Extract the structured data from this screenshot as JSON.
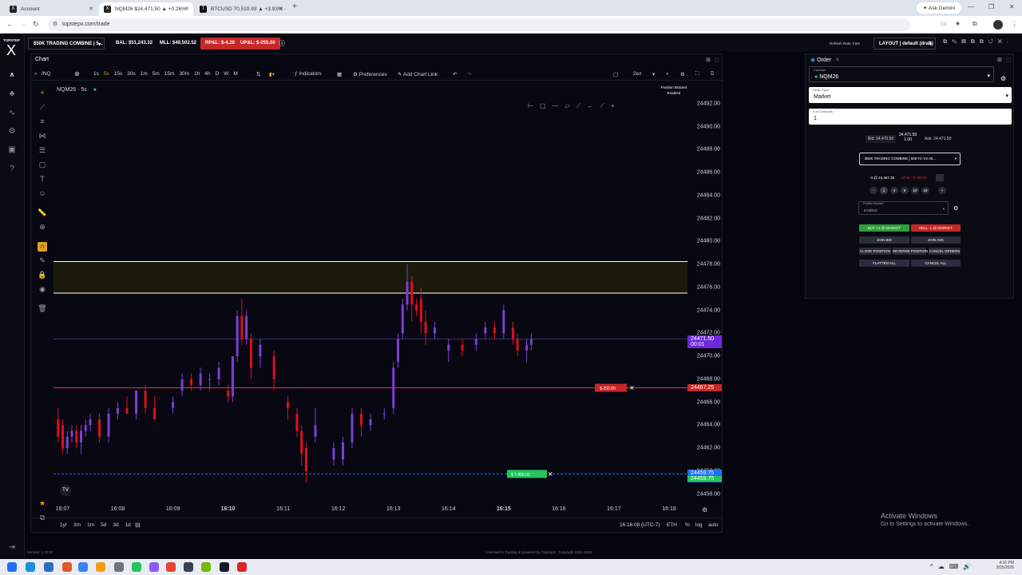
{
  "browser": {
    "tabs": [
      {
        "label": "Account",
        "active": false
      },
      {
        "label": "NQM26 $24,471.50 ▲ +0.26%",
        "active": true
      },
      {
        "label": "BTCUSD 70,510.93 ▲ +3.93% ·",
        "active": false
      }
    ],
    "url": "topstepx.com/trade",
    "profile_label": "Ask Gemini"
  },
  "app": {
    "brand": "TOPSTEP",
    "brand_mark": "X",
    "account_selector": "$50K TRADING COMBINE | 5...",
    "balance": "BAL: $51,243.32",
    "mll": "MLL: $49,502.52",
    "rpnl": "RP&L: $-4.20",
    "upnl": "UP&L: $-255.00",
    "refresh_status": "Refresh Rate: Fast",
    "layout_selector": "LAYOUT | default (draft)",
    "version": "Version: 1.22.57",
    "footer": "Licensed to Topstep & powered by TopstepX. Copyright 2024-2026"
  },
  "chart": {
    "panel_title": "Chart",
    "symbol_search": "/NQ",
    "timeframes": [
      "1s",
      "5s",
      "15s",
      "30s",
      "1m",
      "5m",
      "15m",
      "30m",
      "1h",
      "4h",
      "D",
      "W",
      "M"
    ],
    "active_timeframe": "5s",
    "indicators_label": "Indicators",
    "preferences_label": "Preferences",
    "add_chart_link_label": "Add Chart Link",
    "layout_code": "2ez",
    "legend": "NQM26 · 5s",
    "position_bracket_title": "Position Bracket",
    "position_bracket_status": "Enabled",
    "price_ticks": [
      "24492.00",
      "24490.00",
      "24488.00",
      "24486.00",
      "24484.00",
      "24482.00",
      "24480.00",
      "24478.00",
      "24476.00",
      "24474.00",
      "24472.00",
      "24470.00",
      "24468.00",
      "24466.00",
      "24464.00",
      "24462.00",
      "24460.00",
      "24458.00"
    ],
    "time_ticks": [
      "16:07",
      "16:08",
      "16:09",
      "16:10",
      "16:11",
      "16:12",
      "16:13",
      "16:14",
      "16:15",
      "16:16",
      "16:17",
      "16:18"
    ],
    "bold_time_ticks": [
      "16:10",
      "16:15"
    ],
    "last_price_label": "24471.50",
    "countdown_label": "00:01",
    "position_price_label": "24467.25",
    "position_pnl_tag": "$-255.00",
    "target_price_label": "24459.75",
    "target_price_label2": "24459.75",
    "target_tag": "$ 7,456.00",
    "range_buttons": [
      "1yr",
      "3m",
      "1m",
      "5d",
      "3d",
      "1d"
    ],
    "clock": "16:16:08 (UTC-7)",
    "session": "ETH",
    "scale_options": [
      "%",
      "log",
      "auto"
    ]
  },
  "chart_data": {
    "type": "candlestick",
    "title": "",
    "symbol": "NQM26",
    "interval": "5s",
    "x_range": [
      "16:06:50",
      "16:18:20"
    ],
    "ylim": [
      24457,
      24494
    ],
    "candles": [
      {
        "t": "16:06:55",
        "o": 24464.5,
        "h": 24465.5,
        "l": 24462.5,
        "c": 24463.0
      },
      {
        "t": "16:07:00",
        "o": 24464.0,
        "h": 24464.5,
        "l": 24461.5,
        "c": 24462.0
      },
      {
        "t": "16:07:05",
        "o": 24462.0,
        "h": 24463.5,
        "l": 24461.5,
        "c": 24463.0
      },
      {
        "t": "16:07:10",
        "o": 24463.0,
        "h": 24464.0,
        "l": 24462.5,
        "c": 24463.5
      },
      {
        "t": "16:07:15",
        "o": 24463.5,
        "h": 24464.0,
        "l": 24462.0,
        "c": 24462.5
      },
      {
        "t": "16:07:20",
        "o": 24462.5,
        "h": 24464.0,
        "l": 24461.5,
        "c": 24463.5
      },
      {
        "t": "16:07:25",
        "o": 24463.5,
        "h": 24464.5,
        "l": 24463.0,
        "c": 24464.0
      },
      {
        "t": "16:07:30",
        "o": 24464.0,
        "h": 24465.0,
        "l": 24463.5,
        "c": 24464.5
      },
      {
        "t": "16:07:40",
        "o": 24464.5,
        "h": 24465.0,
        "l": 24462.5,
        "c": 24463.0
      },
      {
        "t": "16:07:50",
        "o": 24463.0,
        "h": 24465.5,
        "l": 24462.5,
        "c": 24465.0
      },
      {
        "t": "16:08:00",
        "o": 24465.0,
        "h": 24466.0,
        "l": 24464.5,
        "c": 24465.5
      },
      {
        "t": "16:08:10",
        "o": 24465.5,
        "h": 24466.5,
        "l": 24465.0,
        "c": 24465.0
      },
      {
        "t": "16:08:20",
        "o": 24465.0,
        "h": 24467.0,
        "l": 24464.5,
        "c": 24467.0
      },
      {
        "t": "16:08:30",
        "o": 24467.0,
        "h": 24467.5,
        "l": 24465.0,
        "c": 24465.5
      },
      {
        "t": "16:08:40",
        "o": 24465.5,
        "h": 24466.5,
        "l": 24464.5,
        "c": 24464.5
      },
      {
        "t": "16:09:00",
        "o": 24465.5,
        "h": 24466.5,
        "l": 24465.0,
        "c": 24466.0
      },
      {
        "t": "16:09:10",
        "o": 24467.0,
        "h": 24468.5,
        "l": 24466.5,
        "c": 24468.0
      },
      {
        "t": "16:09:20",
        "o": 24468.0,
        "h": 24468.5,
        "l": 24467.0,
        "c": 24467.5
      },
      {
        "t": "16:09:30",
        "o": 24467.5,
        "h": 24469.0,
        "l": 24467.0,
        "c": 24468.5
      },
      {
        "t": "16:09:40",
        "o": 24468.0,
        "h": 24468.5,
        "l": 24467.0,
        "c": 24468.0
      },
      {
        "t": "16:09:50",
        "o": 24468.0,
        "h": 24469.5,
        "l": 24467.5,
        "c": 24469.0
      },
      {
        "t": "16:10:00",
        "o": 24467.0,
        "h": 24467.5,
        "l": 24466.0,
        "c": 24466.5
      },
      {
        "t": "16:10:05",
        "o": 24466.5,
        "h": 24470.0,
        "l": 24466.0,
        "c": 24470.0
      },
      {
        "t": "16:10:10",
        "o": 24470.0,
        "h": 24474.0,
        "l": 24469.5,
        "c": 24473.5
      },
      {
        "t": "16:10:15",
        "o": 24473.5,
        "h": 24475.0,
        "l": 24471.0,
        "c": 24471.5
      },
      {
        "t": "16:10:20",
        "o": 24471.5,
        "h": 24474.0,
        "l": 24471.0,
        "c": 24473.5
      },
      {
        "t": "16:10:25",
        "o": 24471.5,
        "h": 24472.0,
        "l": 24468.0,
        "c": 24469.0
      },
      {
        "t": "16:10:35",
        "o": 24470.0,
        "h": 24471.5,
        "l": 24469.0,
        "c": 24471.0
      },
      {
        "t": "16:10:50",
        "o": 24470.0,
        "h": 24470.5,
        "l": 24467.0,
        "c": 24468.0
      },
      {
        "t": "16:11:05",
        "o": 24466.0,
        "h": 24466.5,
        "l": 24464.5,
        "c": 24465.5
      },
      {
        "t": "16:11:15",
        "o": 24465.0,
        "h": 24465.5,
        "l": 24463.0,
        "c": 24463.5
      },
      {
        "t": "16:11:20",
        "o": 24463.5,
        "h": 24464.0,
        "l": 24460.5,
        "c": 24461.5
      },
      {
        "t": "16:11:25",
        "o": 24462.0,
        "h": 24462.5,
        "l": 24459.0,
        "c": 24460.0
      },
      {
        "t": "16:11:35",
        "o": 24463.0,
        "h": 24465.5,
        "l": 24462.5,
        "c": 24464.0
      },
      {
        "t": "16:11:55",
        "o": 24461.0,
        "h": 24462.5,
        "l": 24460.5,
        "c": 24462.0
      },
      {
        "t": "16:12:05",
        "o": 24461.0,
        "h": 24463.0,
        "l": 24460.5,
        "c": 24462.5
      },
      {
        "t": "16:12:15",
        "o": 24462.5,
        "h": 24465.5,
        "l": 24462.0,
        "c": 24465.0
      },
      {
        "t": "16:12:25",
        "o": 24465.0,
        "h": 24465.5,
        "l": 24463.0,
        "c": 24464.0
      },
      {
        "t": "16:12:35",
        "o": 24464.0,
        "h": 24465.0,
        "l": 24463.5,
        "c": 24464.5
      },
      {
        "t": "16:12:50",
        "o": 24465.0,
        "h": 24465.5,
        "l": 24464.5,
        "c": 24465.0
      },
      {
        "t": "16:13:00",
        "o": 24465.5,
        "h": 24469.5,
        "l": 24465.0,
        "c": 24469.0
      },
      {
        "t": "16:13:05",
        "o": 24469.5,
        "h": 24472.0,
        "l": 24469.0,
        "c": 24471.5
      },
      {
        "t": "16:13:10",
        "o": 24472.0,
        "h": 24475.0,
        "l": 24471.5,
        "c": 24474.5
      },
      {
        "t": "16:13:15",
        "o": 24474.5,
        "h": 24478.0,
        "l": 24474.0,
        "c": 24476.5
      },
      {
        "t": "16:13:20",
        "o": 24476.5,
        "h": 24477.0,
        "l": 24473.0,
        "c": 24474.5
      },
      {
        "t": "16:13:25",
        "o": 24474.5,
        "h": 24475.0,
        "l": 24473.5,
        "c": 24474.0
      },
      {
        "t": "16:13:30",
        "o": 24475.0,
        "h": 24476.0,
        "l": 24472.0,
        "c": 24473.0
      },
      {
        "t": "16:13:35",
        "o": 24473.0,
        "h": 24474.0,
        "l": 24471.0,
        "c": 24472.0
      },
      {
        "t": "16:13:45",
        "o": 24472.0,
        "h": 24473.0,
        "l": 24471.5,
        "c": 24472.5
      },
      {
        "t": "16:14:00",
        "o": 24470.5,
        "h": 24471.5,
        "l": 24469.5,
        "c": 24471.0
      },
      {
        "t": "16:14:15",
        "o": 24471.0,
        "h": 24471.5,
        "l": 24470.0,
        "c": 24470.5
      },
      {
        "t": "16:14:30",
        "o": 24471.0,
        "h": 24472.0,
        "l": 24470.5,
        "c": 24471.5
      },
      {
        "t": "16:14:40",
        "o": 24472.0,
        "h": 24473.0,
        "l": 24471.5,
        "c": 24472.5
      },
      {
        "t": "16:14:50",
        "o": 24472.5,
        "h": 24473.0,
        "l": 24471.5,
        "c": 24472.0
      },
      {
        "t": "16:15:00",
        "o": 24472.0,
        "h": 24474.5,
        "l": 24471.5,
        "c": 24474.0
      },
      {
        "t": "16:15:10",
        "o": 24472.5,
        "h": 24473.0,
        "l": 24471.0,
        "c": 24471.5
      },
      {
        "t": "16:15:15",
        "o": 24471.5,
        "h": 24472.0,
        "l": 24470.0,
        "c": 24470.5
      },
      {
        "t": "16:15:25",
        "o": 24470.5,
        "h": 24471.5,
        "l": 24469.5,
        "c": 24471.0
      },
      {
        "t": "16:15:30",
        "o": 24471.0,
        "h": 24472.0,
        "l": 24470.5,
        "c": 24471.5
      }
    ],
    "horizontal_lines": [
      {
        "price": 24478.25,
        "color": "#ffffff",
        "label": ""
      },
      {
        "price": 24475.5,
        "color": "#ffffff",
        "label": ""
      },
      {
        "price": 24467.25,
        "color": "#e53935",
        "label": "24467.25"
      },
      {
        "price": 24471.5,
        "color": "#3b2a7a",
        "label": "24471.50"
      },
      {
        "price": 24459.75,
        "color": "#1f6fff",
        "label": "24459.75"
      }
    ],
    "shaded_zone": {
      "from": 24475.5,
      "to": 24478.25,
      "color": "#1a1a0a"
    },
    "colors": {
      "up": "#7b3fd6",
      "down": "#e0101a"
    }
  },
  "order": {
    "panel_title": "Order",
    "contract_label": "Contract",
    "contract_value": "NQM26",
    "order_type_label": "Order Type",
    "order_type_value": "Market",
    "contracts_label": "# of Contracts",
    "contracts_value": "1",
    "bid": "Bid: 24,470.50",
    "last": "24,471.50",
    "last_size": "1.00",
    "ask": "Ask: 24,471.50",
    "account": "$50K TRADING COMBINE | 50KTC-V2-45...",
    "position": "-3 @ 24,467.25",
    "upnl": "UP&L: $-255.00",
    "qty_buttons": [
      "1",
      "3",
      "5",
      "10",
      "15"
    ],
    "bracket_label": "Position Bracket",
    "bracket_value": "Enabled",
    "buy_market": "BUY +1 @ MARKET",
    "sell_market": "SELL -1 @ MARKET",
    "join_bid": "JOIN BID",
    "join_ask": "JOIN ASK",
    "close_position": "CLOSE POSITION",
    "reverse_position": "REVERSE POSITION",
    "cancel_orders": "CANCEL ORDERS",
    "flatten_all": "FLATTEN ALL",
    "cancel_all": "CANCEL ALL"
  },
  "windows": {
    "activate_title": "Activate Windows",
    "activate_sub": "Go to Settings to activate Windows.",
    "time": "4:16 PM",
    "date": "3/25/2026"
  },
  "colors": {
    "accent_green": "#2e9e3a",
    "accent_red": "#c62828",
    "accent_purple": "#6d28d9"
  }
}
